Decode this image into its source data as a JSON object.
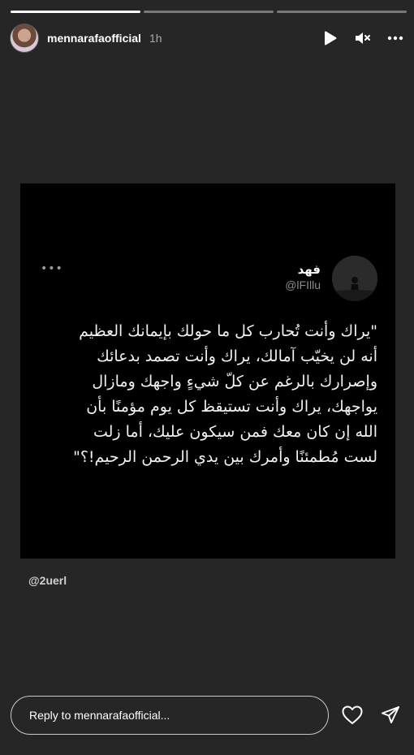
{
  "progress": [
    1,
    0,
    0
  ],
  "header": {
    "username": "mennarafaofficial",
    "time": "1h",
    "icons": [
      "play-icon",
      "mute-icon",
      "more-icon"
    ]
  },
  "tweet": {
    "name": "فهد",
    "handle": "@lFIllu",
    "more": "•••",
    "text": "\"يراك وأنت تُحارب كل ما حولك بإيمانك العظيم\nأنه لن يخيّب آمالك، يراك وأنت تصمد بدعائك\nوإصرارك بالرغم عن كلّ شيءٍ واجهك ومازال\nيواجهك، يراك وأنت تستيقظ كل يوم مؤمنًا بأن\nالله إن كان معك فمن سيكون عليك، أما زلت\nلست مُطمئنًا وأمرك بين يدي الرحمن الرحيم!؟\""
  },
  "credit": "@2uerl",
  "footer": {
    "reply_placeholder": "Reply to mennarafaofficial..."
  },
  "colors": {
    "background": "#262626",
    "card": "#000000",
    "text": "#ffffff"
  }
}
